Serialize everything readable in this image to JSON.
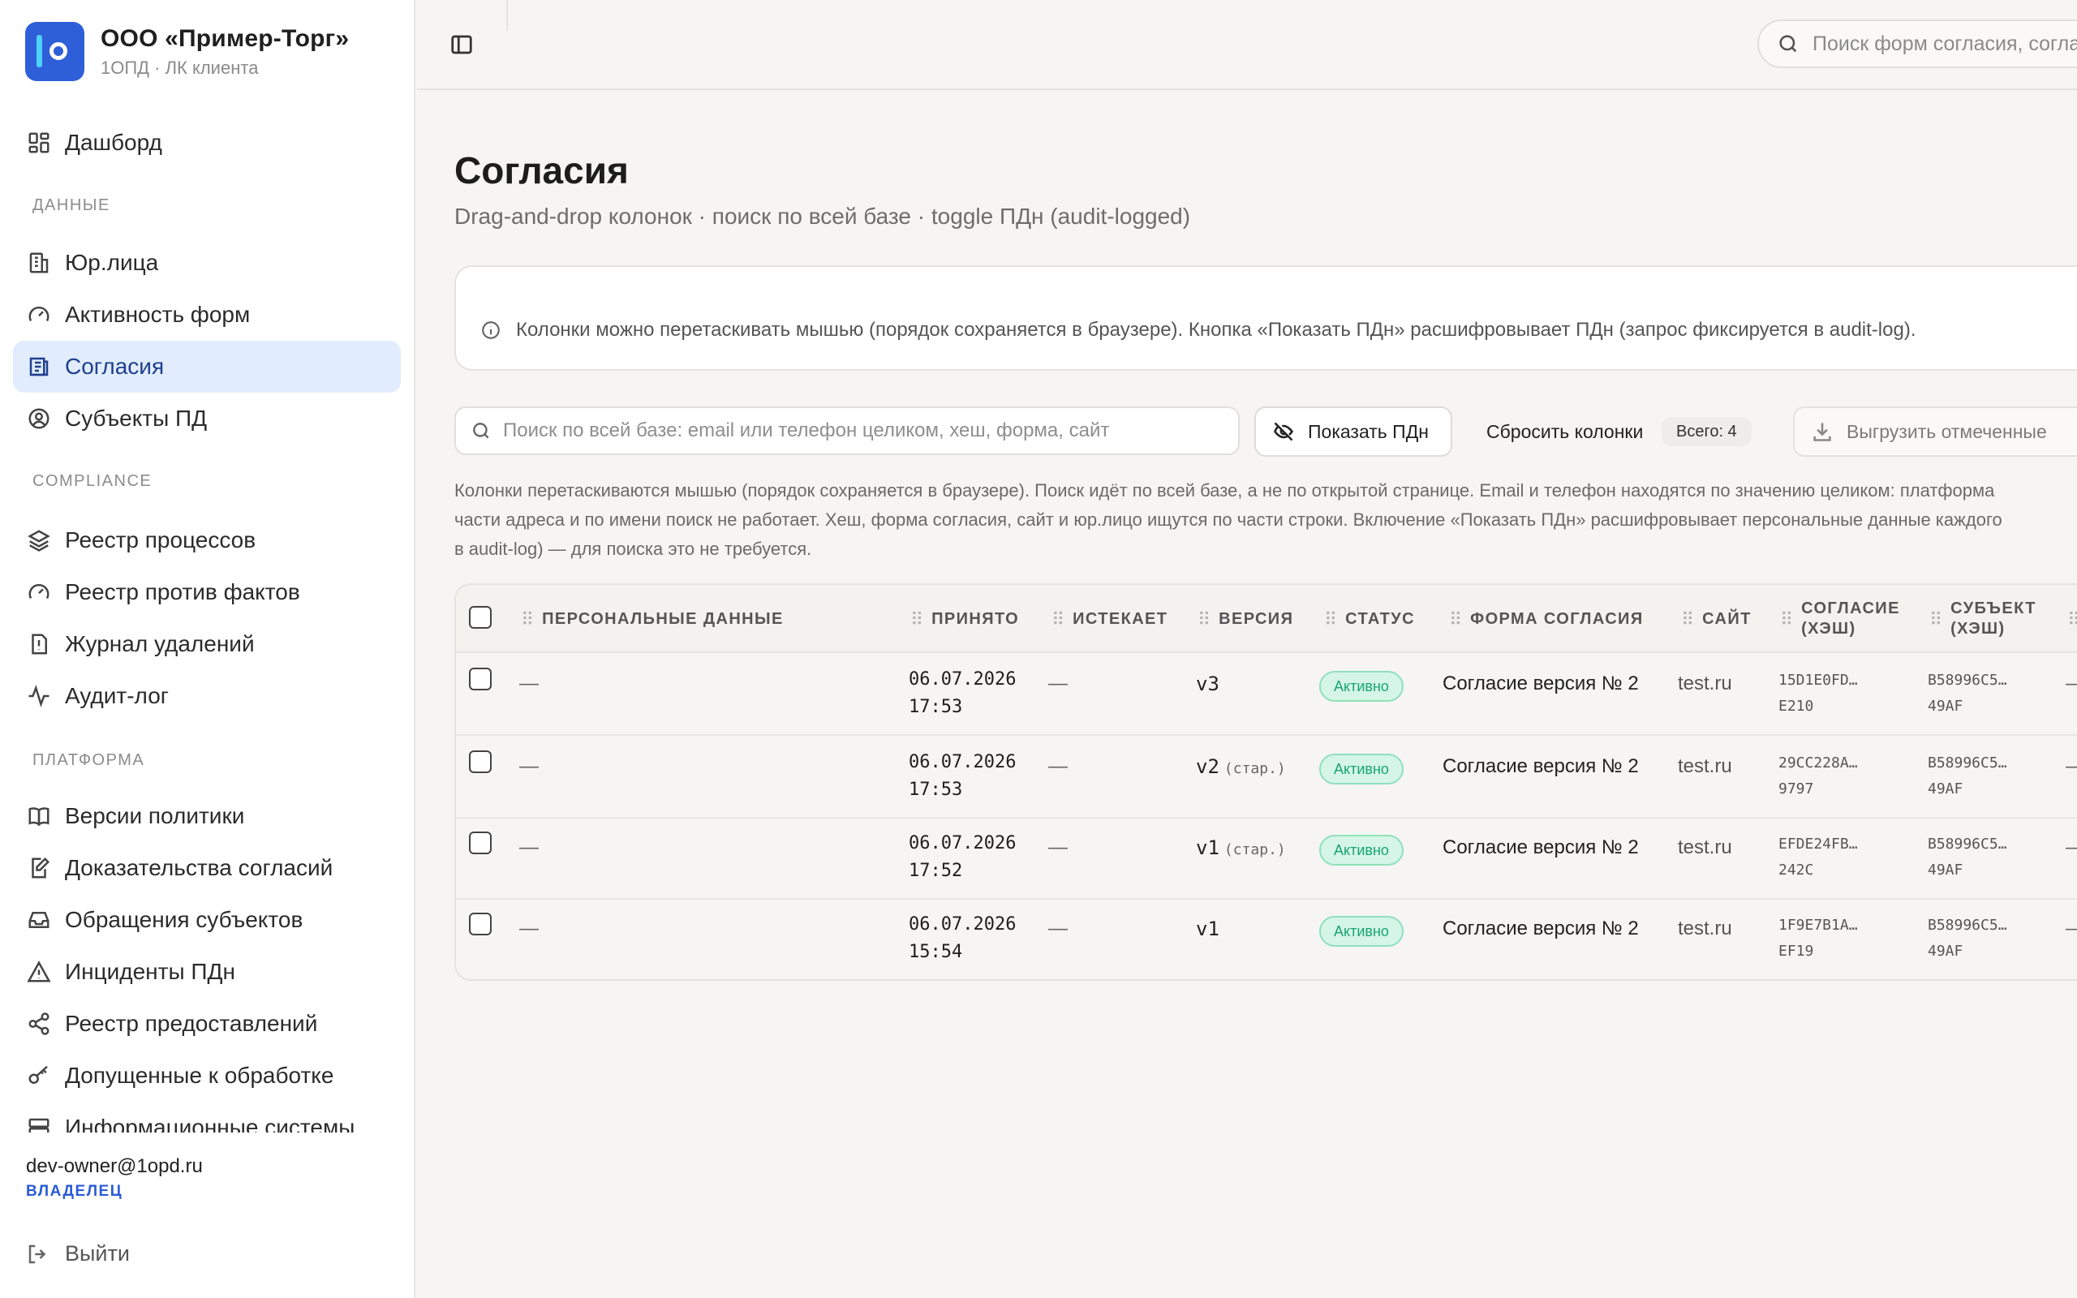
{
  "brand": {
    "name": "ООО «Пример-Торг»",
    "subtitle": "1ОПД · ЛК клиента"
  },
  "sidebar": {
    "top_items": [
      {
        "label": "Дашборд",
        "icon": "dashboard-icon"
      }
    ],
    "sections": [
      {
        "title": "ДАННЫЕ",
        "items": [
          {
            "label": "Юр.лица",
            "icon": "building-icon"
          },
          {
            "label": "Активность форм",
            "icon": "gauge-icon"
          },
          {
            "label": "Согласия",
            "icon": "consent-list-icon",
            "active": true
          },
          {
            "label": "Субъекты ПД",
            "icon": "user-circle-icon"
          }
        ]
      },
      {
        "title": "COMPLIANCE",
        "items": [
          {
            "label": "Реестр процессов",
            "icon": "layers-icon"
          },
          {
            "label": "Реестр против фактов",
            "icon": "gauge-icon"
          },
          {
            "label": "Журнал удалений",
            "icon": "file-alert-icon"
          },
          {
            "label": "Аудит-лог",
            "icon": "activity-icon"
          }
        ]
      },
      {
        "title": "ПЛАТФОРМА",
        "items": [
          {
            "label": "Версии политики",
            "icon": "book-icon"
          },
          {
            "label": "Доказательства согласий",
            "icon": "file-edit-icon"
          },
          {
            "label": "Обращения субъектов",
            "icon": "inbox-icon"
          },
          {
            "label": "Инциденты ПДн",
            "icon": "warning-icon"
          },
          {
            "label": "Реестр предоставлений",
            "icon": "share-icon"
          },
          {
            "label": "Допущенные к обработке",
            "icon": "key-icon"
          },
          {
            "label": "Информационные системы",
            "icon": "server-icon"
          }
        ]
      }
    ],
    "user": {
      "email": "dev-owner@1opd.ru",
      "role": "ВЛАДЕЛЕЦ"
    },
    "logout_label": "Выйти"
  },
  "topbar": {
    "search_placeholder": "Поиск форм согласия, согласий"
  },
  "page": {
    "title": "Согласия",
    "subtitle": "Drag-and-drop колонок · поиск по всей базе · toggle ПДн (audit-logged)",
    "info": "Колонки можно перетаскивать мышью (порядок сохраняется в браузере). Кнопка «Показать ПДн» расшифровывает ПДн (запрос фиксируется в audit-log).",
    "help_lines": [
      "Колонки перетаскиваются мышью (порядок сохраняется в браузере). Поиск идёт по всей базе, а не по открытой странице. Email и телефон находятся по значению целиком: платформа",
      "части адреса и по имени поиск не работает. Хеш, форма согласия, сайт и юр.лицо ищутся по части строки. Включение «Показать ПДн» расшифровывает персональные данные каждого",
      "в audit-log) — для поиска это не требуется."
    ]
  },
  "toolbar": {
    "search_placeholder": "Поиск по всей базе: email или телефон целиком, хеш, форма, сайт",
    "show_pd_label": "Показать ПДн",
    "reset_columns_label": "Сбросить колонки",
    "total_label": "Всего: 4",
    "export_label": "Выгрузить отмеченные"
  },
  "table": {
    "columns": [
      {
        "key": "pd",
        "label": "ПЕРСОНАЛЬНЫЕ ДАННЫЕ"
      },
      {
        "key": "accepted",
        "label": "ПРИНЯТО"
      },
      {
        "key": "expires",
        "label": "ИСТЕКАЕТ"
      },
      {
        "key": "version",
        "label": "ВЕРСИЯ"
      },
      {
        "key": "status",
        "label": "СТАТУС"
      },
      {
        "key": "form",
        "label": "ФОРМА СОГЛАСИЯ"
      },
      {
        "key": "site",
        "label": "САЙТ"
      },
      {
        "key": "consent_hash",
        "label": "СОГЛАСИЕ (ХЭШ)",
        "line1": "СОГЛАСИЕ",
        "line2": "(ХЭШ)"
      },
      {
        "key": "subject_hash",
        "label": "СУБЪЕКТ (ХЭШ)",
        "line1": "СУБЪЕКТ",
        "line2": "(ХЭШ)"
      }
    ],
    "rows": [
      {
        "pd": "—",
        "accepted_date": "06.07.2026",
        "accepted_time": "17:53",
        "expires": "—",
        "version": "v3",
        "version_note": "",
        "status": "Активно",
        "form": "Согласие версия № 2",
        "site": "test.ru",
        "consent_hash_1": "15D1E0FD…",
        "consent_hash_2": "E210",
        "subject_hash_1": "B58996C5…",
        "subject_hash_2": "49AF",
        "extra": "—"
      },
      {
        "pd": "—",
        "accepted_date": "06.07.2026",
        "accepted_time": "17:53",
        "expires": "—",
        "version": "v2",
        "version_note": "(стар.)",
        "status": "Активно",
        "form": "Согласие версия № 2",
        "site": "test.ru",
        "consent_hash_1": "29CC228A…",
        "consent_hash_2": "9797",
        "subject_hash_1": "B58996C5…",
        "subject_hash_2": "49AF",
        "extra": "—"
      },
      {
        "pd": "—",
        "accepted_date": "06.07.2026",
        "accepted_time": "17:52",
        "expires": "—",
        "version": "v1",
        "version_note": "(стар.)",
        "status": "Активно",
        "form": "Согласие версия № 2",
        "site": "test.ru",
        "consent_hash_1": "EFDE24FB…",
        "consent_hash_2": "242C",
        "subject_hash_1": "B58996C5…",
        "subject_hash_2": "49AF",
        "extra": "—"
      },
      {
        "pd": "—",
        "accepted_date": "06.07.2026",
        "accepted_time": "15:54",
        "expires": "—",
        "version": "v1",
        "version_note": "",
        "status": "Активно",
        "form": "Согласие версия № 2",
        "site": "test.ru",
        "consent_hash_1": "1F9E7B1A…",
        "consent_hash_2": "EF19",
        "subject_hash_1": "B58996C5…",
        "subject_hash_2": "49AF",
        "extra": "—"
      }
    ]
  },
  "colors": {
    "accent": "#2f5fd8",
    "active_nav_bg": "#e1edfc",
    "status_active_bg": "#d5f5e6",
    "status_active_text": "#18a572"
  }
}
